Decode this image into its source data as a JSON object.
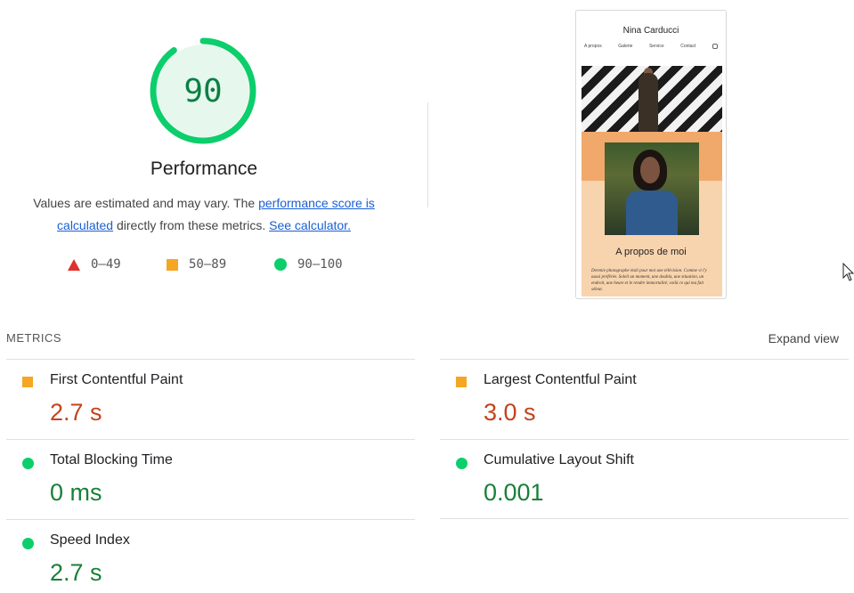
{
  "score": {
    "value": "90",
    "title": "Performance",
    "description_before": "Values are estimated and may vary. The ",
    "score_link": "performance score is calculated",
    "description_middle": " directly from these metrics. ",
    "calculator_link": "See calculator.",
    "gauge_fraction": 0.9,
    "colors": {
      "good": "#0cce6b",
      "good_text": "#0b8043",
      "track": "#e6f8ed"
    }
  },
  "legend": [
    {
      "shape": "triangle-icon",
      "range": "0–49",
      "color": "#e0302b"
    },
    {
      "shape": "square-icon",
      "range": "50–89",
      "color": "#f5a623"
    },
    {
      "shape": "circle-icon",
      "range": "90–100",
      "color": "#0cce6b"
    }
  ],
  "screenshot": {
    "site_name": "Nina Carducci",
    "nav": [
      "A propos",
      "Galerie",
      "Service",
      "Contact"
    ],
    "nav_icon": "instagram-icon",
    "heading": "A propos de moi",
    "body_text": "Derenie photographe étali pour moi une télévision. Comme vi l'y aussi préférée. Soleil un moment, une doubla, une situation, un endroit, une heure et le rendre immortalité, voilà ce qui ma fait séleur."
  },
  "metrics": {
    "section_label": "METRICS",
    "expand_label": "Expand view",
    "items": [
      {
        "name": "First Contentful Paint",
        "value": "2.7 s",
        "rating": "average",
        "icon": "orange-square-icon"
      },
      {
        "name": "Largest Contentful Paint",
        "value": "3.0 s",
        "rating": "average",
        "icon": "orange-square-icon"
      },
      {
        "name": "Total Blocking Time",
        "value": "0 ms",
        "rating": "good",
        "icon": "green-circle-icon"
      },
      {
        "name": "Cumulative Layout Shift",
        "value": "0.001",
        "rating": "good",
        "icon": "green-circle-icon"
      },
      {
        "name": "Speed Index",
        "value": "2.7 s",
        "rating": "good",
        "icon": "green-circle-icon"
      }
    ]
  }
}
